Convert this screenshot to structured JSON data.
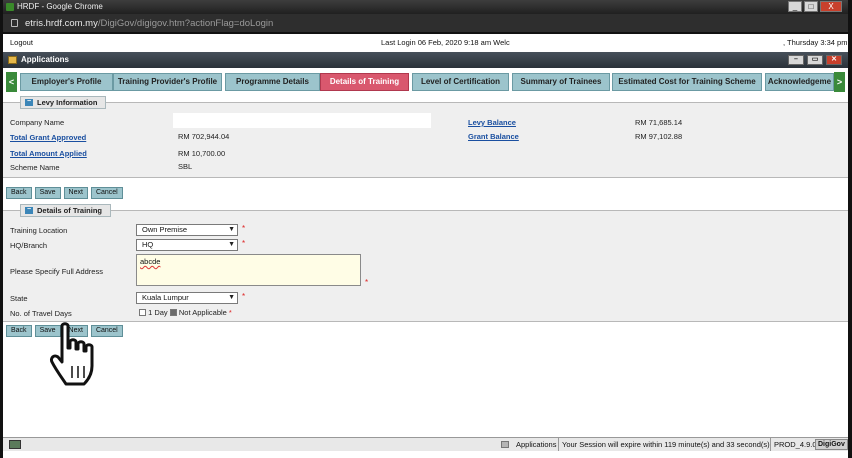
{
  "browser": {
    "title": "HRDF - Google Chrome",
    "url_host": "etris.hrdf.com.my",
    "url_rest": "/DigiGov/digigov.htm?actionFlag=doLogin",
    "min": "_",
    "max": "□",
    "close": "X"
  },
  "topbar": {
    "logout": "Logout",
    "last_login": "Last Login 06 Feb, 2020 9:18 am   Welc",
    "date": ", Thursday 3:34 pm"
  },
  "app_header": {
    "title": "Applications"
  },
  "tabs": {
    "prev": "<",
    "next": ">",
    "items": [
      {
        "label": "Employer's Profile"
      },
      {
        "label": "Training Provider's Profile"
      },
      {
        "label": "Programme Details"
      },
      {
        "label": "Details of Training"
      },
      {
        "label": "Level of Certification"
      },
      {
        "label": "Summary of Trainees"
      },
      {
        "label": "Estimated Cost for Training Scheme"
      },
      {
        "label": "Acknowledgeme"
      }
    ],
    "active_index": 3
  },
  "levy": {
    "title": "Levy Information",
    "company_name_label": "Company Name",
    "total_grant_label": "Total Grant Approved",
    "total_grant_value": "RM 702,944.04",
    "total_amount_label": "Total Amount Applied",
    "total_amount_value": "RM 10,700.00",
    "scheme_label": "Scheme Name",
    "scheme_value": "SBL",
    "levy_balance_label": "Levy Balance",
    "levy_balance_value": "RM 71,685.14",
    "grant_balance_label": "Grant Balance",
    "grant_balance_value": "RM 97,102.88"
  },
  "buttons": {
    "back": "Back",
    "save": "Save",
    "next": "Next",
    "cancel": "Cancel"
  },
  "training": {
    "title": "Details of Training",
    "location_label": "Training Location",
    "location_value": "Own Premise",
    "branch_label": "HQ/Branch",
    "branch_value": "HQ",
    "address_label": "Please Specify Full Address",
    "address_value": "abcde",
    "state_label": "State",
    "state_value": "Kuala Lumpur",
    "travel_label": "No. of Travel Days",
    "opt_1day": "1 Day",
    "opt_na": "Not Applicable",
    "required": "*"
  },
  "statusbar": {
    "apps": "Applications",
    "session": "Your Session will expire within 119 minute(s) and 33 second(s)",
    "prod": "PROD_4.9.0",
    "logo": "DigiGov"
  },
  "colors": {
    "tab": "#9cc4cc",
    "tab_active": "#d9586e",
    "link": "#1a4fa0"
  }
}
